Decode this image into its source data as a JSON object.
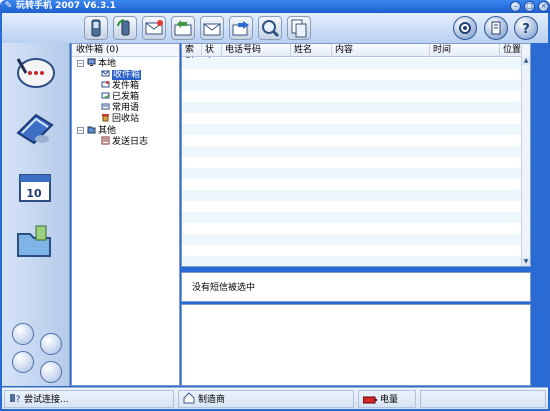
{
  "app": {
    "title": "玩转手机 2007 V6.3.1"
  },
  "title_buttons": [
    "minimize",
    "restore",
    "close"
  ],
  "toolbar": {
    "tools": [
      "phone-icon",
      "refresh-phone-icon",
      "new-message-icon",
      "reply-icon",
      "receive-icon",
      "send-icon",
      "search-icon",
      "copy-icon"
    ],
    "right_tools": [
      "settings-icon",
      "notes-icon",
      "help-icon"
    ]
  },
  "sidebar": {
    "icons": [
      "messages-icon",
      "contacts-icon",
      "calendar-icon",
      "files-icon"
    ]
  },
  "tree": {
    "header": "收件箱 (0)",
    "root_local": "本地",
    "local_items": [
      "收件箱",
      "发件箱",
      "已发箱",
      "常用语",
      "回收站"
    ],
    "root_other": "其他",
    "other_items": [
      "发送日志"
    ]
  },
  "grid": {
    "columns": [
      "索引",
      "状态",
      "电话号码",
      "姓名",
      "内容",
      "时间",
      "位置"
    ]
  },
  "preview": {
    "text": "没有短信被选中"
  },
  "status": {
    "connection": "尝试连接...",
    "manufacturer": "制造商",
    "battery": "电量"
  },
  "colors": {
    "title_bar": "#2a6ad3",
    "selection": "#2a5fc9",
    "row_alt": "#eef7fb"
  }
}
